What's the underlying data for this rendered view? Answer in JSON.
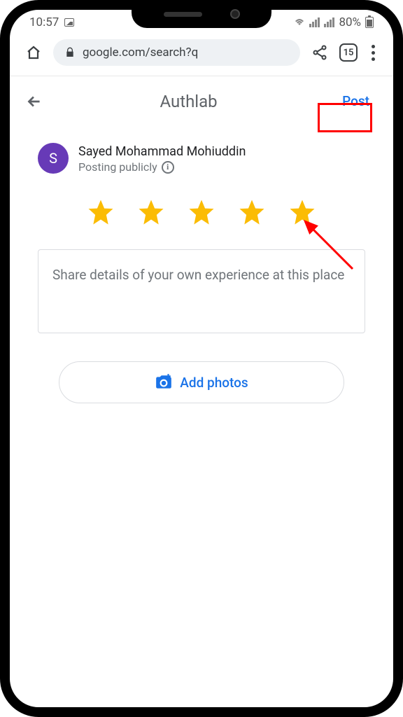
{
  "status": {
    "time": "10:57",
    "battery_pct": "80%"
  },
  "browser": {
    "url": "google.com/search?q",
    "tab_count": "15"
  },
  "header": {
    "title": "Authlab",
    "post_label": "Post"
  },
  "user": {
    "avatar_initial": "S",
    "name": "Sayed Mohammad Mohiuddin",
    "visibility": "Posting publicly"
  },
  "rating": {
    "stars": 5
  },
  "review": {
    "placeholder": "Share details of your own experience at this place"
  },
  "actions": {
    "add_photos": "Add photos"
  }
}
